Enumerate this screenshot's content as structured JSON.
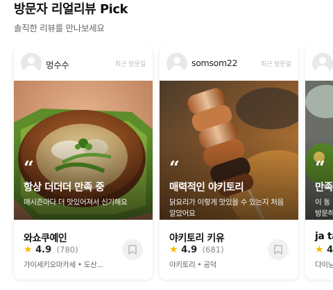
{
  "section": {
    "title": "방문자 리얼리뷰 Pick",
    "subtitle": "솔직한 리뷰를 만나보세요"
  },
  "cards": [
    {
      "user": "멍수수",
      "visit_label": "최근 방문일",
      "quote_title": "항상 더더더 만족 중",
      "quote_text": "매시즌마다 더 맛있어져서 신기해요",
      "restaurant": "와쇼쿠예인",
      "rating": "4.9",
      "count": "(780)",
      "location": "가이세키오마카세 • 도산..."
    },
    {
      "user": "somsom22",
      "visit_label": "최근 방문일",
      "quote_title": "매력적인 야키토리",
      "quote_text": "닭요리가 이렇게 맛있을 수 있는지 처음 알았어요",
      "restaurant": "야키토리 키유",
      "rating": "4.9",
      "count": "(681)",
      "location": "야키토리 • 공덕"
    },
    {
      "user": "",
      "visit_label": "",
      "quote_title": "만족",
      "quote_text": "이 동 방문하",
      "restaurant": "ja ta",
      "rating": "4",
      "count": "",
      "location": "다이닝"
    }
  ],
  "icons": {
    "quote": "quote-icon",
    "star": "star-icon",
    "bookmark": "bookmark-icon",
    "avatar": "avatar-icon"
  },
  "colors": {
    "star": "#f5b800",
    "visit_label": "#bbbbbb"
  }
}
